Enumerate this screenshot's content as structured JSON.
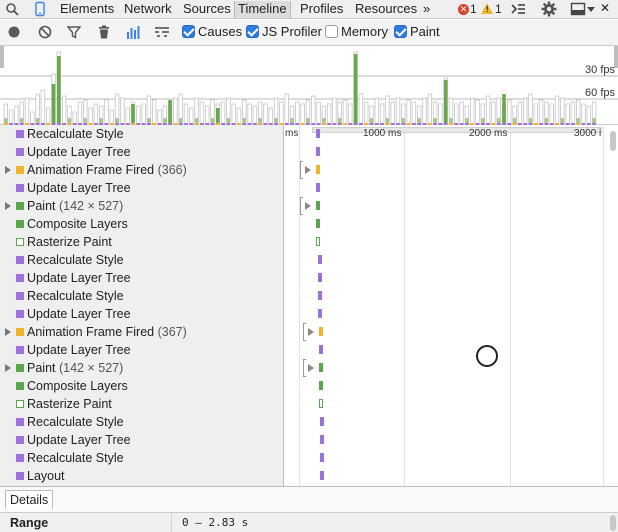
{
  "tabs": [
    "Elements",
    "Network",
    "Sources",
    "Timeline",
    "Profiles",
    "Resources"
  ],
  "selected_tab": "Timeline",
  "more_tabs": "»",
  "error_count": "1",
  "warning_count": "1",
  "error_glyph": "✕",
  "warning_glyph": "!",
  "close_glyph": "✕",
  "toolbar": {
    "causes_label": "Causes",
    "causes_checked": true,
    "js_profiler_label": "JS Profiler",
    "js_profiler_checked": true,
    "memory_label": "Memory",
    "memory_checked": false,
    "paint_label": "Paint",
    "paint_checked": true
  },
  "overview": {
    "fps_labels": [
      "30 fps",
      "60 fps"
    ]
  },
  "colors": {
    "purple": "#9b72d8",
    "yellow": "#f0b42b",
    "green": "#5ba74b",
    "gray_bar": "#dcdcdc"
  },
  "records": [
    {
      "label": "Recalculate Style",
      "cat": "purple",
      "expandable": false
    },
    {
      "label": "Update Layer Tree",
      "cat": "purple",
      "expandable": false
    },
    {
      "label": "Animation Frame Fired",
      "detail": "(366)",
      "cat": "yellow",
      "expandable": true
    },
    {
      "label": "Update Layer Tree",
      "cat": "purple",
      "expandable": false
    },
    {
      "label": "Paint",
      "detail": "(142 × 527)",
      "cat": "green",
      "expandable": true
    },
    {
      "label": "Composite Layers",
      "cat": "green",
      "expandable": false
    },
    {
      "label": "Rasterize Paint",
      "cat": "green-hollow",
      "expandable": false
    },
    {
      "label": "Recalculate Style",
      "cat": "purple",
      "expandable": false
    },
    {
      "label": "Update Layer Tree",
      "cat": "purple",
      "expandable": false
    },
    {
      "label": "Recalculate Style",
      "cat": "purple",
      "expandable": false
    },
    {
      "label": "Update Layer Tree",
      "cat": "purple",
      "expandable": false
    },
    {
      "label": "Animation Frame Fired",
      "detail": "(367)",
      "cat": "yellow",
      "expandable": true
    },
    {
      "label": "Update Layer Tree",
      "cat": "purple",
      "expandable": false
    },
    {
      "label": "Paint",
      "detail": "(142 × 527)",
      "cat": "green",
      "expandable": true
    },
    {
      "label": "Composite Layers",
      "cat": "green",
      "expandable": false
    },
    {
      "label": "Rasterize Paint",
      "cat": "green-hollow",
      "expandable": false
    },
    {
      "label": "Recalculate Style",
      "cat": "purple",
      "expandable": false
    },
    {
      "label": "Update Layer Tree",
      "cat": "purple",
      "expandable": false
    },
    {
      "label": "Recalculate Style",
      "cat": "purple",
      "expandable": false
    },
    {
      "label": "Layout",
      "cat": "purple",
      "expandable": false
    }
  ],
  "timeline": {
    "ticks": [
      "ms",
      "1000 ms",
      "2000 ms",
      "3000 i"
    ]
  },
  "details": {
    "tab_label": "Details",
    "range_label": "Range",
    "range_value": "0 – 2.83 s"
  }
}
